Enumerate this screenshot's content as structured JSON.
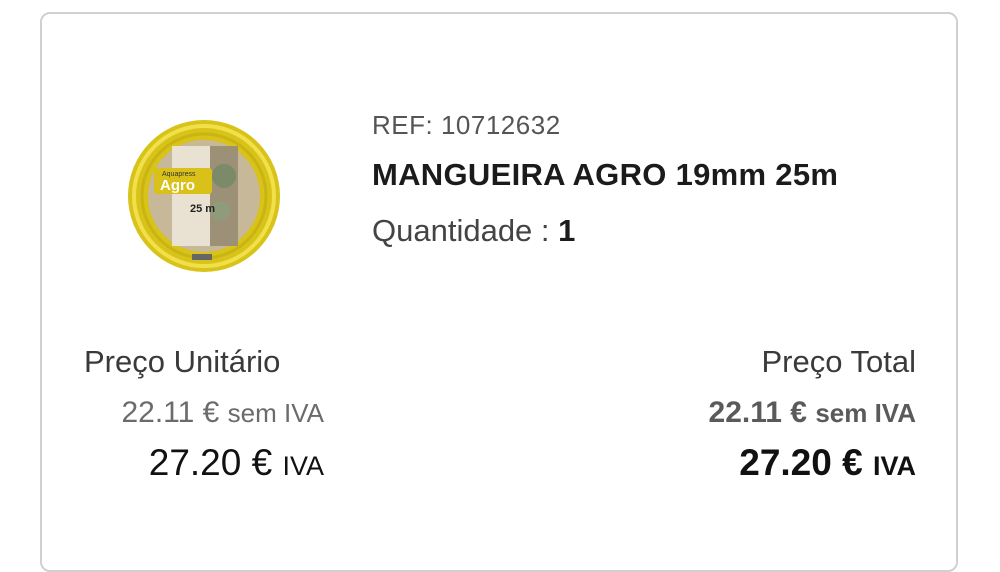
{
  "product": {
    "ref_label": "REF:",
    "ref_value": "10712632",
    "name": "MANGUEIRA AGRO 19mm 25m",
    "quantity_label": "Quantidade :",
    "quantity_value": "1",
    "image": {
      "brand_small": "Aquapress",
      "brand": "Agro",
      "length": "25 m",
      "hose_color": "#e6d21e"
    }
  },
  "unit_price": {
    "label": "Preço Unitário",
    "net_value": "22.11 €",
    "net_suffix": "sem IVA",
    "gross_value": "27.20 €",
    "gross_suffix": "IVA"
  },
  "total_price": {
    "label": "Preço Total",
    "net_value": "22.11 €",
    "net_suffix": "sem IVA",
    "gross_value": "27.20 €",
    "gross_suffix": "IVA"
  }
}
